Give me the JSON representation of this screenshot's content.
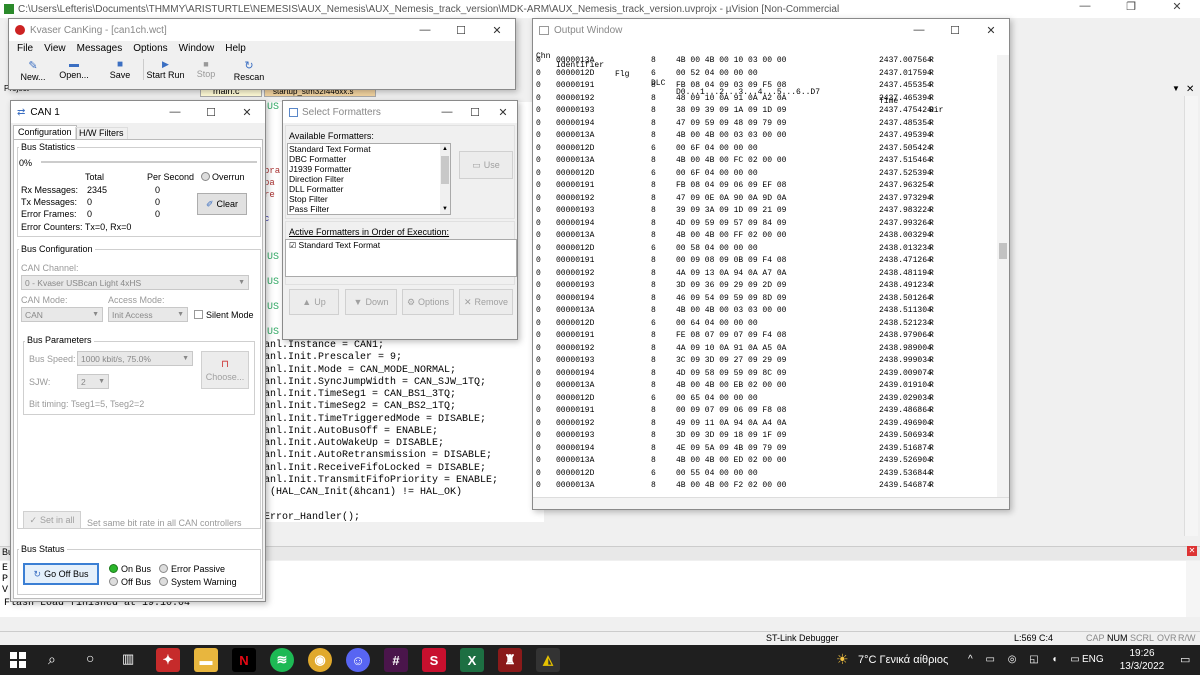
{
  "ide": {
    "title": "C:\\Users\\Lefteris\\Documents\\THMMY\\ARISTURTLE\\NEMESIS\\AUX_Nemesis\\AUX_Nemesis_track_version\\MDK-ARM\\AUX_Nemesis_track_version.uvprojx - µVision  [Non-Commercial",
    "tab_main": "main.c",
    "tab_startup": "startup_stm32f446xx.s",
    "project_label": "Project",
    "left_snippets": [
      "bra",
      "pa",
      "re",
      "c"
    ],
    "us_labels": [
      "US",
      "US",
      "US",
      "US",
      "US"
    ],
    "code_lines": [
      "anl.Instance = CAN1;",
      "anl.Init.Prescaler = 9;",
      "anl.Init.Mode = CAN_MODE_NORMAL;",
      "anl.Init.SyncJumpWidth = CAN_SJW_1TQ;",
      "anl.Init.TimeSeg1 = CAN_BS1_3TQ;",
      "anl.Init.TimeSeg2 = CAN_BS2_1TQ;",
      "anl.Init.TimeTriggeredMode = DISABLE;",
      "anl.Init.AutoBusOff = ENABLE;",
      "anl.Init.AutoWakeUp = DISABLE;",
      "anl.Init.AutoRetransmission = DISABLE;",
      "anl.Init.ReceiveFifoLocked = DISABLE;",
      "anl.Init.TransmitFifoPriority = ENABLE;",
      " (HAL_CAN_Init(&hcan1) != HAL_OK)",
      "",
      "Error_Handler();"
    ],
    "build_label": "Bu",
    "build_output": "Flash Load finished at 19:10:04",
    "build_left": [
      "E",
      "P",
      "V"
    ],
    "status_debugger": "ST-Link Debugger",
    "status_pos": "L:569 C:4",
    "status_caps": "CAP",
    "status_num": "NUM",
    "status_scrl": "SCRL",
    "status_ovr": "OVR",
    "status_rw": "R/W"
  },
  "canking": {
    "title": "Kvaser CanKing - [can1ch.wct]",
    "menu": [
      "File",
      "View",
      "Messages",
      "Options",
      "Window",
      "Help"
    ],
    "toolbar": [
      {
        "label": "New...",
        "icon": "edit-icon"
      },
      {
        "label": "Open...",
        "icon": "folder-icon"
      },
      {
        "label": "Save",
        "icon": "save-icon"
      },
      {
        "label": "Start Run",
        "icon": "play-icon"
      },
      {
        "label": "Stop",
        "icon": "stop-icon"
      },
      {
        "label": "Rescan",
        "icon": "refresh-icon"
      }
    ]
  },
  "can1": {
    "title": "CAN 1",
    "tabs": [
      "Configuration",
      "H/W Filters"
    ],
    "stats_title": "Bus Statistics",
    "percent": "0%",
    "col_total": "Total",
    "col_persec": "Per Second",
    "overrun": "Overrun",
    "rows": [
      {
        "label": "Rx Messages:",
        "total": "2345",
        "persec": "0"
      },
      {
        "label": "Tx Messages:",
        "total": "0",
        "persec": "0"
      },
      {
        "label": "Error Frames:",
        "total": "0",
        "persec": "0"
      }
    ],
    "error_counters": "Error Counters:  Tx=0, Rx=0",
    "clear": "Clear",
    "config_title": "Bus Configuration",
    "can_channel_label": "CAN Channel:",
    "can_channel_value": "0 - Kvaser USBcan Light 4xHS",
    "can_mode_label": "CAN Mode:",
    "can_mode_value": "CAN",
    "access_mode_label": "Access Mode:",
    "access_mode_value": "Init Access",
    "silent_mode": "Silent Mode",
    "params_title": "Bus Parameters",
    "bus_speed_label": "Bus Speed:",
    "bus_speed_value": "1000 kbit/s, 75.0%",
    "sjw_label": "SJW:",
    "sjw_value": "2",
    "choose": "Choose...",
    "bit_timing": "Bit timing:   Tseg1=5, Tseg2=2",
    "set_in_all": "Set in all",
    "set_in_all_desc": "Set same bit rate in all CAN controllers",
    "status_title": "Bus Status",
    "go_off_bus": "Go Off Bus",
    "on_bus": "On Bus",
    "off_bus": "Off Bus",
    "error_passive": "Error Passive",
    "system_warning": "System Warning"
  },
  "formatters": {
    "title": "Select Formatters",
    "available_label": "Available Formatters:",
    "available": [
      "Standard Text Format",
      "DBC Formatter",
      "J1939 Formatter",
      "Direction Filter",
      "DLL Formatter",
      "Stop Filter",
      "Pass Filter"
    ],
    "use": "Use",
    "active_label": "Active Formatters in Order of Execution:",
    "active": [
      "Standard Text Format"
    ],
    "up": "Up",
    "down": "Down",
    "options": "Options",
    "remove": "Remove"
  },
  "output": {
    "title": "Output Window",
    "headers": [
      "Chn",
      "Identifier",
      "Flg",
      "DLC",
      "D0...1...2...3...4...5...6..D7",
      "Time",
      "Dir"
    ],
    "rows": [
      [
        "0",
        "0000013A",
        "",
        "8",
        "4B 00 4B 00 10 03 00 00",
        "2437.007564",
        "R"
      ],
      [
        "0",
        "0000012D",
        "",
        "6",
        "00 52 04 00 00 00",
        "2437.017594",
        "R"
      ],
      [
        "0",
        "00000191",
        "",
        "8",
        "FB 08 04 09 03 09 F5 08",
        "2437.455354",
        "R"
      ],
      [
        "0",
        "00000192",
        "",
        "8",
        "48 09 10 0A 91 0A A2 0A",
        "2437.465394",
        "R"
      ],
      [
        "0",
        "00000193",
        "",
        "8",
        "38 09 39 09 1A 09 1D 09",
        "2437.475424",
        "R"
      ],
      [
        "0",
        "00000194",
        "",
        "8",
        "47 09 59 09 48 09 79 09",
        "2437.485354",
        "R"
      ],
      [
        "0",
        "0000013A",
        "",
        "8",
        "4B 00 4B 00 03 03 00 00",
        "2437.495394",
        "R"
      ],
      [
        "0",
        "0000012D",
        "",
        "6",
        "00 6F 04 00 00 00",
        "2437.505424",
        "R"
      ],
      [
        "0",
        "0000013A",
        "",
        "8",
        "4B 00 4B 00 FC 02 00 00",
        "2437.515464",
        "R"
      ],
      [
        "0",
        "0000012D",
        "",
        "6",
        "00 6F 04 00 00 00",
        "2437.525394",
        "R"
      ],
      [
        "0",
        "00000191",
        "",
        "8",
        "FB 08 04 09 06 09 EF 08",
        "2437.963254",
        "R"
      ],
      [
        "0",
        "00000192",
        "",
        "8",
        "47 09 0E 0A 90 0A 9D 0A",
        "2437.973294",
        "R"
      ],
      [
        "0",
        "00000193",
        "",
        "8",
        "39 09 3A 09 1D 09 21 09",
        "2437.983224",
        "R"
      ],
      [
        "0",
        "00000194",
        "",
        "8",
        "4D 09 59 09 57 09 84 09",
        "2437.993264",
        "R"
      ],
      [
        "0",
        "0000013A",
        "",
        "8",
        "4B 00 4B 00 FF 02 00 00",
        "2438.003294",
        "R"
      ],
      [
        "0",
        "0000012D",
        "",
        "6",
        "00 58 04 00 00 00",
        "2438.013234",
        "R"
      ],
      [
        "0",
        "00000191",
        "",
        "8",
        "00 09 08 09 0B 09 F4 08",
        "2438.471264",
        "R"
      ],
      [
        "0",
        "00000192",
        "",
        "8",
        "4A 09 13 0A 94 0A A7 0A",
        "2438.481194",
        "R"
      ],
      [
        "0",
        "00000193",
        "",
        "8",
        "3D 09 36 09 29 09 2D 09",
        "2438.491234",
        "R"
      ],
      [
        "0",
        "00000194",
        "",
        "8",
        "46 09 54 09 59 09 8D 09",
        "2438.501264",
        "R"
      ],
      [
        "0",
        "0000013A",
        "",
        "8",
        "4B 00 4B 00 03 03 00 00",
        "2438.511304",
        "R"
      ],
      [
        "0",
        "0000012D",
        "",
        "6",
        "00 64 04 00 00 00",
        "2438.521234",
        "R"
      ],
      [
        "0",
        "00000191",
        "",
        "8",
        "FE 08 07 09 07 09 F4 08",
        "2438.979064",
        "R"
      ],
      [
        "0",
        "00000192",
        "",
        "8",
        "4A 09 10 0A 91 0A A5 0A",
        "2438.989004",
        "R"
      ],
      [
        "0",
        "00000193",
        "",
        "8",
        "3C 09 3D 09 27 09 29 09",
        "2438.999034",
        "R"
      ],
      [
        "0",
        "00000194",
        "",
        "8",
        "4D 09 58 09 59 09 8C 09",
        "2439.009074",
        "R"
      ],
      [
        "0",
        "0000013A",
        "",
        "8",
        "4B 00 4B 00 EB 02 00 00",
        "2439.019104",
        "R"
      ],
      [
        "0",
        "0000012D",
        "",
        "6",
        "00 65 04 00 00 00",
        "2439.029034",
        "R"
      ],
      [
        "0",
        "00000191",
        "",
        "8",
        "00 09 07 09 06 09 F8 08",
        "2439.486864",
        "R"
      ],
      [
        "0",
        "00000192",
        "",
        "8",
        "49 09 11 0A 94 0A A4 0A",
        "2439.496904",
        "R"
      ],
      [
        "0",
        "00000193",
        "",
        "8",
        "3D 09 3D 09 18 09 1F 09",
        "2439.506934",
        "R"
      ],
      [
        "0",
        "00000194",
        "",
        "8",
        "4E 09 5A 09 4B 09 79 09",
        "2439.516874",
        "R"
      ],
      [
        "0",
        "0000013A",
        "",
        "8",
        "4B 00 4B 00 ED 02 00 00",
        "2439.526904",
        "R"
      ],
      [
        "0",
        "0000012D",
        "",
        "6",
        "00 55 04 00 00 00",
        "2439.536844",
        "R"
      ],
      [
        "0",
        "0000013A",
        "",
        "8",
        "4B 00 4B 00 F2 02 00 00",
        "2439.546874",
        "R"
      ]
    ]
  },
  "taskbar": {
    "weather": "7°C Γενικά αίθριος",
    "lang": "ENG",
    "time": "19:26",
    "date": "13/3/2022"
  }
}
